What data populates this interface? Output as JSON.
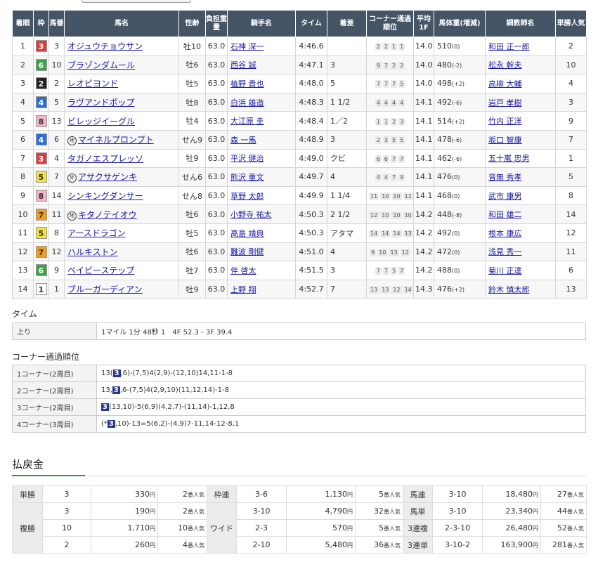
{
  "headers": {
    "order": "着順",
    "waku": "枠",
    "num": "馬番",
    "name": "馬名",
    "sex": "性齢",
    "weight": "負担重量",
    "jockey": "騎手名",
    "time": "タイム",
    "margin": "着差",
    "corner": "コーナー通過順位",
    "avg": "平均1F",
    "body": "馬体重(増減)",
    "trainer": "調教師名",
    "pop": "単勝人気"
  },
  "rows": [
    {
      "order": "1",
      "waku": "3",
      "num": "3",
      "mark": "",
      "name": "オジュウチョウサン",
      "sex": "牡10",
      "wt": "63.0",
      "jockey": "石神 深一",
      "time": "4:46.6",
      "margin": "",
      "corners": [
        "2",
        "2",
        "1",
        "1"
      ],
      "avg": "14.0",
      "body": "510",
      "diff": "(0)",
      "trainer": "和田 正一郎",
      "pop": "2"
    },
    {
      "order": "2",
      "waku": "6",
      "num": "10",
      "mark": "",
      "name": "ブラゾンダムール",
      "sex": "牡6",
      "wt": "63.0",
      "jockey": "西谷 誠",
      "time": "4:47.1",
      "margin": "3",
      "corners": [
        "9",
        "7",
        "2",
        "2"
      ],
      "avg": "14.0",
      "body": "480",
      "diff": "(-2)",
      "trainer": "松永 幹夫",
      "pop": "10"
    },
    {
      "order": "3",
      "waku": "2",
      "num": "2",
      "mark": "",
      "name": "レオビヨンド",
      "sex": "牡5",
      "wt": "63.0",
      "jockey": "植野 貴也",
      "time": "4:48.0",
      "margin": "5",
      "corners": [
        "7",
        "7",
        "7",
        "5"
      ],
      "avg": "14.0",
      "body": "498",
      "diff": "(+2)",
      "trainer": "高柳 大輔",
      "pop": "4"
    },
    {
      "order": "4",
      "waku": "4",
      "num": "5",
      "mark": "",
      "name": "ラヴアンドポップ",
      "sex": "牡8",
      "wt": "63.0",
      "jockey": "白浜 雄造",
      "time": "4:48.3",
      "margin": "1 1/2",
      "corners": [
        "4",
        "4",
        "4",
        "4"
      ],
      "avg": "14.1",
      "body": "492",
      "diff": "(-6)",
      "trainer": "岩戸 孝樹",
      "pop": "3"
    },
    {
      "order": "5",
      "waku": "8",
      "num": "13",
      "mark": "",
      "name": "ビレッジイーグル",
      "sex": "牡4",
      "wt": "63.0",
      "jockey": "大江原 圭",
      "time": "4:48.4",
      "margin": "1／2",
      "corners": [
        "1",
        "1",
        "2",
        "3"
      ],
      "avg": "14.1",
      "body": "514",
      "diff": "(+2)",
      "trainer": "竹内 正洋",
      "pop": "9"
    },
    {
      "order": "6",
      "waku": "4",
      "num": "6",
      "mark": "地",
      "name": "マイネルプロンプト",
      "sex": "せん9",
      "wt": "63.0",
      "jockey": "森 一馬",
      "time": "4:48.9",
      "margin": "3",
      "corners": [
        "2",
        "3",
        "5",
        "5"
      ],
      "avg": "14.1",
      "body": "478",
      "diff": "(-6)",
      "trainer": "坂口 智康",
      "pop": "7"
    },
    {
      "order": "7",
      "waku": "3",
      "num": "4",
      "mark": "",
      "name": "タガノエスプレッソ",
      "sex": "牡9",
      "wt": "63.0",
      "jockey": "平沢 健治",
      "time": "4:49.0",
      "margin": "クビ",
      "corners": [
        "6",
        "6",
        "7",
        "7"
      ],
      "avg": "14.1",
      "body": "462",
      "diff": "(-6)",
      "trainer": "五十嵐 忠男",
      "pop": "1"
    },
    {
      "order": "8",
      "waku": "5",
      "num": "7",
      "mark": "外",
      "name": "アサクサゲンキ",
      "sex": "せん6",
      "wt": "63.0",
      "jockey": "熊沢 重文",
      "time": "4:49.7",
      "margin": "4",
      "corners": [
        "4",
        "4",
        "7",
        "9"
      ],
      "avg": "14.1",
      "body": "476",
      "diff": "(0)",
      "trainer": "音無 秀孝",
      "pop": "5"
    },
    {
      "order": "9",
      "waku": "8",
      "num": "14",
      "mark": "",
      "name": "シンキングダンサー",
      "sex": "せん8",
      "wt": "63.0",
      "jockey": "草野 太郎",
      "time": "4:49.9",
      "margin": "1 1/4",
      "corners": [
        "11",
        "10",
        "10",
        "11"
      ],
      "avg": "14.1",
      "body": "468",
      "diff": "(0)",
      "trainer": "武市 康男",
      "pop": "8"
    },
    {
      "order": "10",
      "waku": "7",
      "num": "11",
      "mark": "地",
      "name": "キタノテイオウ",
      "sex": "牡6",
      "wt": "63.0",
      "jockey": "小野寺 祐太",
      "time": "4:50.3",
      "margin": "2 1/2",
      "corners": [
        "12",
        "10",
        "10",
        "10"
      ],
      "avg": "14.2",
      "body": "448",
      "diff": "(-8)",
      "trainer": "和田 雄二",
      "pop": "14"
    },
    {
      "order": "11",
      "waku": "5",
      "num": "8",
      "mark": "",
      "name": "アースドラゴン",
      "sex": "牡5",
      "wt": "63.0",
      "jockey": "高島 靖典",
      "time": "4:50.3",
      "margin": "アタマ",
      "corners": [
        "14",
        "14",
        "14",
        "13"
      ],
      "avg": "14.2",
      "body": "492",
      "diff": "(0)",
      "trainer": "根本 康広",
      "pop": "12"
    },
    {
      "order": "12",
      "waku": "7",
      "num": "12",
      "mark": "",
      "name": "ハルキストン",
      "sex": "牡6",
      "wt": "63.0",
      "jockey": "難波 剛健",
      "time": "4:51.0",
      "margin": "4",
      "corners": [
        "9",
        "10",
        "13",
        "12"
      ],
      "avg": "14.2",
      "body": "472",
      "diff": "(0)",
      "trainer": "浅見 秀一",
      "pop": "11"
    },
    {
      "order": "13",
      "waku": "6",
      "num": "9",
      "mark": "",
      "name": "ベイビーステップ",
      "sex": "牡7",
      "wt": "63.0",
      "jockey": "伴 啓太",
      "time": "4:51.5",
      "margin": "3",
      "corners": [
        "7",
        "7",
        "5",
        "7"
      ],
      "avg": "14.2",
      "body": "488",
      "diff": "(0)",
      "trainer": "菊川 正達",
      "pop": "6"
    },
    {
      "order": "14",
      "waku": "1",
      "num": "1",
      "mark": "",
      "name": "ブルーガーディアン",
      "sex": "牡9",
      "wt": "63.0",
      "jockey": "上野 翔",
      "time": "4:52.7",
      "margin": "7",
      "corners": [
        "13",
        "13",
        "12",
        "14"
      ],
      "avg": "14.3",
      "body": "476",
      "diff": "(+2)",
      "trainer": "鈴木 慎太郎",
      "pop": "13"
    }
  ],
  "waku_colors": {
    "1": {
      "bg": "#ffffff",
      "fg": "#333333"
    },
    "2": {
      "bg": "#222222",
      "fg": "#ffffff"
    },
    "3": {
      "bg": "#e03a3a",
      "fg": "#ffffff"
    },
    "4": {
      "bg": "#2b6fd6",
      "fg": "#ffffff"
    },
    "5": {
      "bg": "#f5e23a",
      "fg": "#333333"
    },
    "6": {
      "bg": "#37a447",
      "fg": "#ffffff"
    },
    "7": {
      "bg": "#f29b1c",
      "fg": "#333333"
    },
    "8": {
      "bg": "#f4b6c6",
      "fg": "#333333"
    }
  },
  "time_section": {
    "title": "タイム",
    "label": "上り",
    "value": "1マイル 1分 48秒 1　4F 52.3 - 3F 39.4"
  },
  "corner_section": {
    "title": "コーナー通過順位",
    "rows": [
      {
        "label": "1コーナー(2周目)",
        "pre": "13(",
        "hl": "3",
        "post": ",6)-(7,5)4(2,9)-(12,10)14,11-1-8"
      },
      {
        "label": "2コーナー(2周目)",
        "pre": "13,",
        "hl": "3",
        "post": ",6-(7,5)4(2,9,10)(11,12,14)-1-8"
      },
      {
        "label": "3コーナー(2周目)",
        "pre": "",
        "hl": "3",
        "post": "(13,10)-5(6,9)(4,2,7)-(11,14)-1,12,8"
      },
      {
        "label": "4コーナー(3周目)",
        "pre": "(*",
        "hl": "3",
        "post": ",10)-13=5(6,2)-(4,9)7-11,14-12-8,1"
      }
    ]
  },
  "payout": {
    "title": "払戻金",
    "tansho": {
      "label": "単勝",
      "num": "3",
      "yen": "330",
      "pop": "2"
    },
    "fukusho": {
      "label": "複勝",
      "rows": [
        {
          "num": "3",
          "yen": "190",
          "pop": "2"
        },
        {
          "num": "10",
          "yen": "1,710",
          "pop": "10"
        },
        {
          "num": "2",
          "yen": "260",
          "pop": "4"
        }
      ]
    },
    "wakuren": {
      "label": "枠連",
      "num": "3-6",
      "yen": "1,130",
      "pop": "5"
    },
    "wide": {
      "label": "ワイド",
      "rows": [
        {
          "num": "3-10",
          "yen": "4,790",
          "pop": "32"
        },
        {
          "num": "2-3",
          "yen": "570",
          "pop": "5"
        },
        {
          "num": "2-10",
          "yen": "5,480",
          "pop": "36"
        }
      ]
    },
    "right": [
      {
        "label": "馬連",
        "num": "3-10",
        "yen": "18,480",
        "pop": "27"
      },
      {
        "label": "馬単",
        "num": "3-10",
        "yen": "23,340",
        "pop": "44"
      },
      {
        "label": "3連複",
        "num": "2-3-10",
        "yen": "26,480",
        "pop": "52"
      },
      {
        "label": "3連単",
        "num": "3-10-2",
        "yen": "163,900",
        "pop": "281"
      }
    ],
    "yen_unit": "円",
    "pop_unit": "番人気"
  }
}
